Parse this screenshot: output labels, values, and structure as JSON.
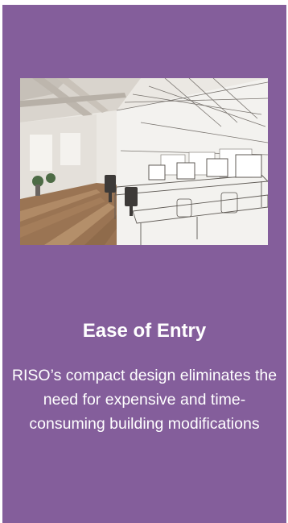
{
  "feature": {
    "image_icon": "office-sketch-illustration",
    "title": "Ease of Entry",
    "description": "RISO’s compact design eliminates the need for expensive and time-consuming building modifications"
  },
  "colors": {
    "card_background": "#845e9b",
    "text": "#ffffff"
  }
}
